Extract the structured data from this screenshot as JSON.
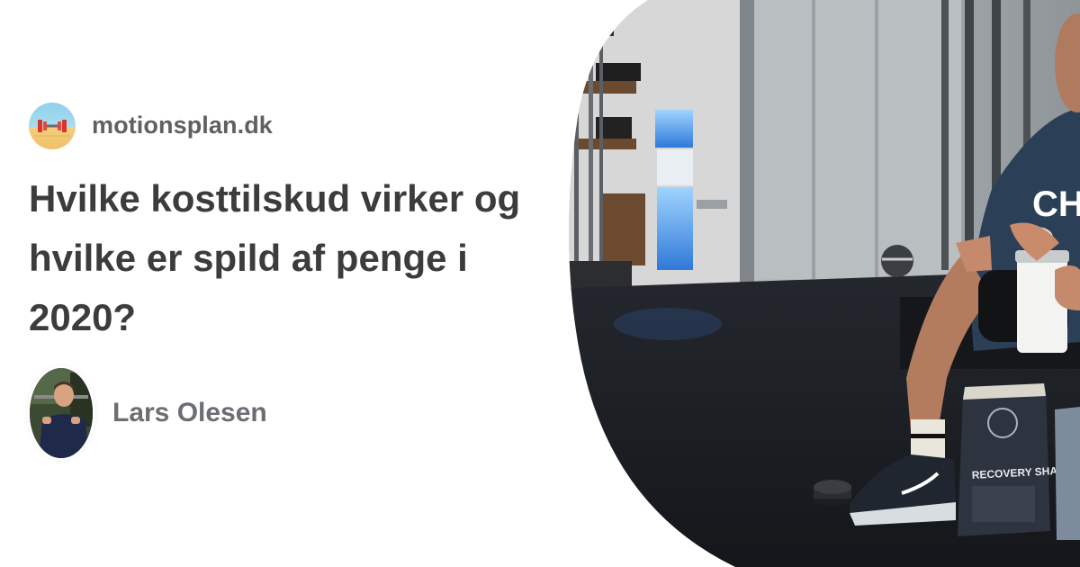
{
  "site": {
    "name": "motionsplan.dk",
    "logo_icon": "dumbbell-icon"
  },
  "article": {
    "title": "Hvilke kosttilskud virker og hvilke er spild af penge i 2020?"
  },
  "author": {
    "name": "Lars Olesen"
  },
  "photo": {
    "shirt_text": "CH",
    "bag_text": "RECOVERY SHAKE"
  },
  "colors": {
    "site_name": "#5f6063",
    "title": "#3c3c3e",
    "author_name": "#6b6e72",
    "background": "#ffffff",
    "photo_floor": "#1a1d22"
  }
}
